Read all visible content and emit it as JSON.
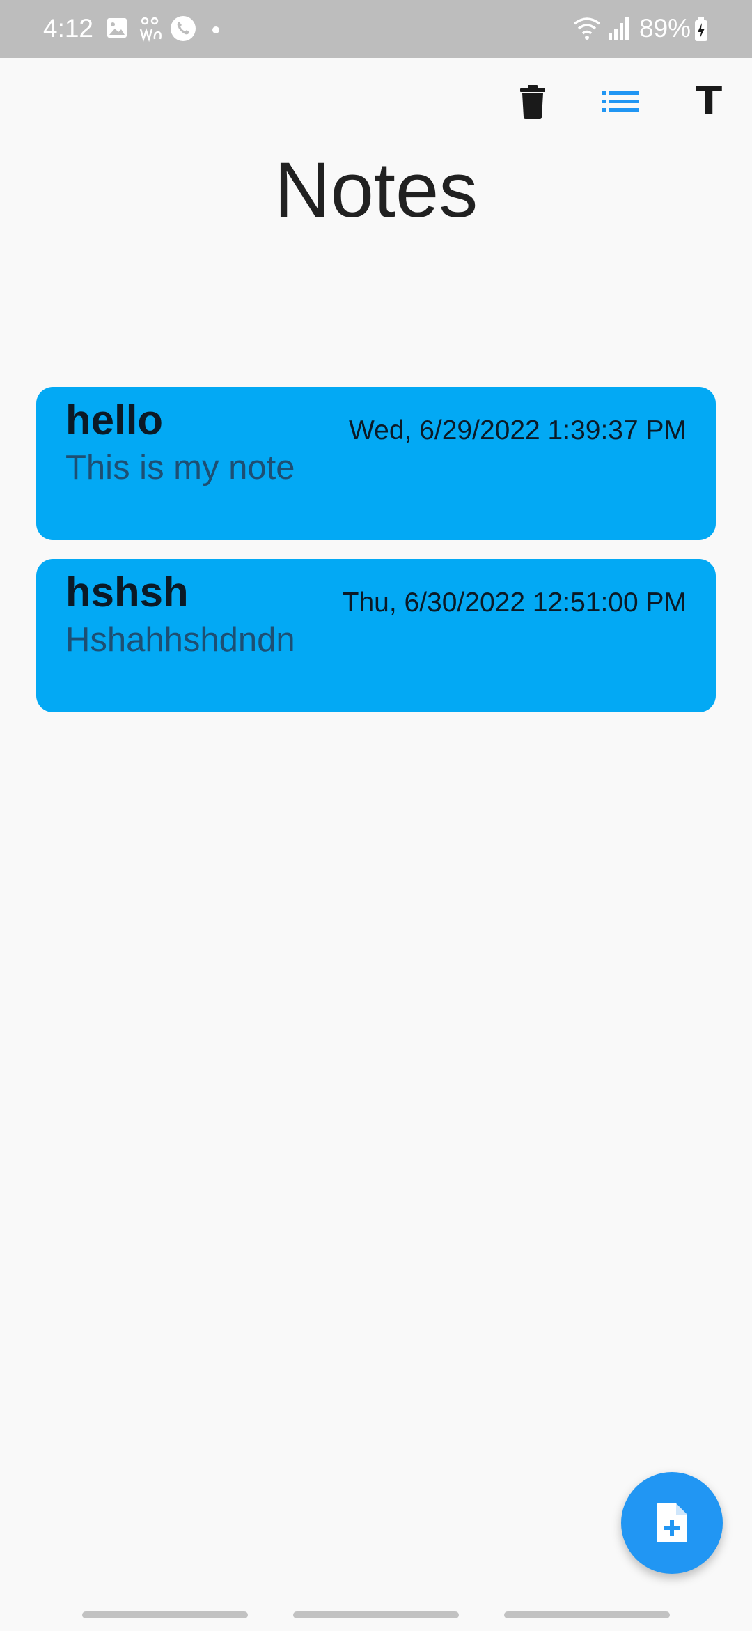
{
  "status_bar": {
    "time": "4:12",
    "battery": "89%",
    "icons": [
      "image-icon",
      "wa-icon",
      "phone-call-icon",
      "dot-icon",
      "wifi-icon",
      "signal-icon",
      "battery-charging-icon"
    ]
  },
  "toolbar": {
    "delete_icon": "trash-icon",
    "list_icon": "list-view-icon",
    "font_label": "T"
  },
  "page": {
    "title": "Notes"
  },
  "notes": [
    {
      "title": "hello",
      "body": "This is my note",
      "date": "Wed, 6/29/2022 1:39:37 PM"
    },
    {
      "title": "hshsh",
      "body": "Hshahhshdndn",
      "date": "Thu, 6/30/2022 12:51:00 PM"
    }
  ],
  "fab": {
    "icon": "add-note-icon"
  },
  "colors": {
    "card": "#03a9f4",
    "accent": "#2196f3",
    "status_bar": "#bdbdbd"
  }
}
